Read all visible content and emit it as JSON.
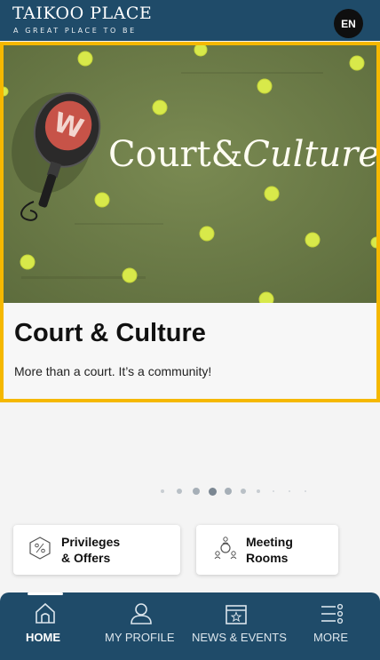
{
  "header": {
    "brand_title": "TAIKOO PLACE",
    "brand_tagline": "A GREAT PLACE TO BE",
    "language_button": "EN"
  },
  "featured": {
    "image_text_primary": "Court&",
    "image_text_italic": "Culture",
    "image_text_dot": ".",
    "title": "Court & Culture",
    "subtitle": "More than a court. It’s a community!",
    "highlight_color": "#f5b800"
  },
  "carousel": {
    "total_pages": 10,
    "active_index": 3
  },
  "quick_actions": {
    "privileges_label_line1": "Privileges",
    "privileges_label_line2": "& Offers",
    "privileges_icon": "percent-tag-icon",
    "meeting_label": "Meeting Rooms",
    "meeting_icon": "meeting-people-icon"
  },
  "nav": {
    "items": [
      {
        "label": "HOME",
        "icon": "home-icon",
        "active": true
      },
      {
        "label": "MY PROFILE",
        "icon": "profile-icon",
        "active": false
      },
      {
        "label": "NEWS & EVENTS",
        "icon": "calendar-star-icon",
        "active": false
      },
      {
        "label": "MORE",
        "icon": "menu-more-icon",
        "active": false
      }
    ]
  },
  "colors": {
    "brand_navy": "#1f4b69",
    "court_green": "#6e7d4a",
    "ball_yellow": "#d8e94a"
  }
}
